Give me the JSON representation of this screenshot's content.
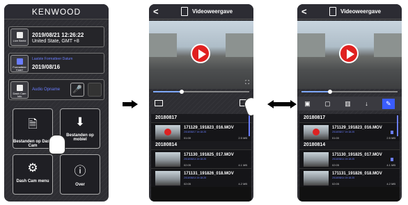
{
  "screen1": {
    "brand": "KENWOOD",
    "live_label": "Live Beeld",
    "datetime": "2019/08/21  12:26:22",
    "timezone": "United State, GMT +8",
    "format_btn": "Formatteer Kaart",
    "format_title": "Laatste Formatteer Datum",
    "format_date": "2019/08/16",
    "audio_btn": "Dash Cam Info",
    "audio_label": "Audio Opname",
    "files_dashcam": "Bestanden op Dash Cam",
    "files_mobile": "Bestanden op mobiel",
    "menu": "Dash Cam menu",
    "about": "Over"
  },
  "screen2": {
    "back": "<",
    "title": "Videoweergave",
    "expand": "⛶",
    "date1": "20180817",
    "date2": "20180814",
    "items": [
      {
        "name": "171129_191823_016.MOV",
        "date": "2018/08/17 19:18:25",
        "time": "01:00",
        "size": "2.5 MB"
      },
      {
        "name": "171130_191825_017.MOV",
        "date": "2018/08/14 19:18:25",
        "time": "02:05",
        "size": "4.1 MB"
      },
      {
        "name": "171131_191826_018.MOV",
        "date": "2018/08/14 19:18:25",
        "time": "02:05",
        "size": "4.2 MB"
      }
    ]
  },
  "screen3": {
    "back": "<",
    "title": "Videoweergave",
    "date1": "20180817",
    "date2": "20180814",
    "items": [
      {
        "name": "171129_191823_016.MOV",
        "date": "2018/08/17 19:18:25",
        "time": "01:00",
        "size": "2.5 MB"
      },
      {
        "name": "171130_191825_017.MOV",
        "date": "2018/08/14 19:18:25",
        "time": "02:05",
        "size": "4.1 MB"
      },
      {
        "name": "171131_191826_018.MOV",
        "date": "2018/08/14 19:18:25",
        "time": "02:05",
        "size": "4.2 MB"
      }
    ]
  },
  "arrow_colors": {
    "main": "#000000"
  }
}
